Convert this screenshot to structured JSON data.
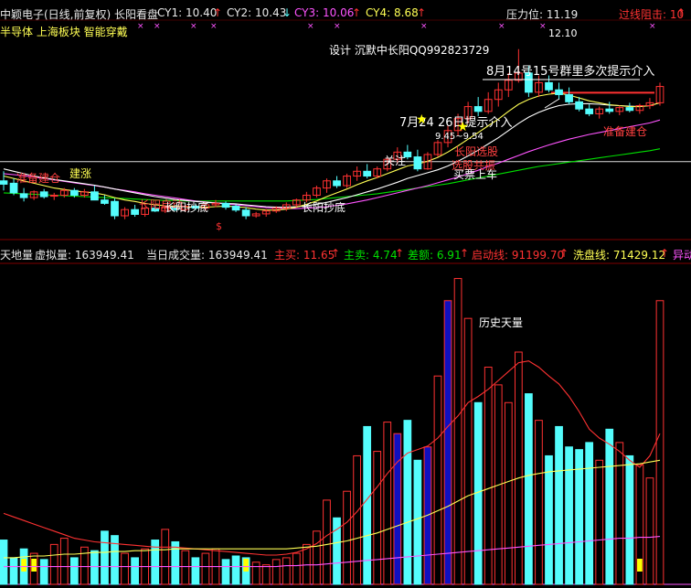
{
  "header1": {
    "title": "中颖电子(日线,前复权) 长阳看盘",
    "cy1": "CY1: 10.40",
    "cy2": "CY2: 10.43",
    "cy3": "CY3: 10.06",
    "cy4": "CY4: 8.68",
    "pressure": "压力位: 11.19",
    "resist": "过线阻击: 10",
    "arrow_up": "↑",
    "arrow_down": "↓"
  },
  "header2": {
    "tags": "半导体 上海板块 智能穿戴"
  },
  "annotations": {
    "design": "设计 沉默中长阳QQ992823729",
    "aug": "8月14号15号群里多次提示介入",
    "jul": "7月24 26日提示介入",
    "price_high": "12.10",
    "range": "9.45~9.54",
    "guanzhu": "关注",
    "changyang_xuangu": "长阳选股",
    "xuangu2": "选股共振",
    "mairu": "买票上车",
    "zhunbei_left": "准备建仓",
    "zhunbei_right": "准备建仓",
    "zhuozhang": "建涨",
    "changyang_qidong": "长阳启动",
    "chaodi1": "长阳抄底",
    "chaodi2": "长阳抄底",
    "s_marker": "$",
    "lishi_tianliang": "历史天量"
  },
  "vol_header": {
    "tiandi": "天地量",
    "xuni": "虚拟量: 163949.41",
    "dangri": "当日成交量: 163949.41",
    "zhumai": "主买: 11.65",
    "zhumai2": "主卖: 4.74",
    "chae": "差额: 6.91",
    "qidong": "启动线: 91199.70",
    "xipan": "洗盘线: 71429.12",
    "yidong": "异动",
    "arrow": "↑"
  },
  "colors": {
    "up": "#ff3232",
    "down": "#54fcfc",
    "ma_white": "#ffffff",
    "ma_yellow": "#ffff54",
    "ma_magenta": "#ff54ff",
    "ma_green": "#00e000",
    "grid": "#800000",
    "label_red": "#ff4040",
    "vol_blue": "#1010c0",
    "vol_yellow": "#ffff00"
  },
  "chart_data": [
    {
      "type": "candlestick",
      "title": "中颖电子(日线,前复权) 长阳看盘",
      "ylim": [
        8.2,
        12.4
      ],
      "reference_lines": {
        "white_line": 9.75,
        "red_line": 11.19
      },
      "candles": [
        {
          "o": 9.35,
          "h": 9.55,
          "l": 9.15,
          "c": 9.28
        },
        {
          "o": 9.3,
          "h": 9.4,
          "l": 9.05,
          "c": 9.1
        },
        {
          "o": 9.08,
          "h": 9.2,
          "l": 8.92,
          "c": 9.0
        },
        {
          "o": 9.0,
          "h": 9.15,
          "l": 8.95,
          "c": 9.12
        },
        {
          "o": 9.12,
          "h": 9.18,
          "l": 8.98,
          "c": 9.02
        },
        {
          "o": 9.03,
          "h": 9.1,
          "l": 8.95,
          "c": 9.05
        },
        {
          "o": 9.05,
          "h": 9.2,
          "l": 9.0,
          "c": 9.15
        },
        {
          "o": 9.15,
          "h": 9.2,
          "l": 9.0,
          "c": 9.05
        },
        {
          "o": 9.05,
          "h": 9.18,
          "l": 9.0,
          "c": 9.12
        },
        {
          "o": 9.12,
          "h": 9.25,
          "l": 9.0,
          "c": 8.95
        },
        {
          "o": 8.95,
          "h": 9.05,
          "l": 8.85,
          "c": 8.88
        },
        {
          "o": 8.92,
          "h": 8.98,
          "l": 8.55,
          "c": 8.62
        },
        {
          "o": 8.62,
          "h": 8.8,
          "l": 8.55,
          "c": 8.75
        },
        {
          "o": 8.75,
          "h": 8.85,
          "l": 8.6,
          "c": 8.65
        },
        {
          "o": 8.65,
          "h": 8.8,
          "l": 8.6,
          "c": 8.78
        },
        {
          "o": 8.78,
          "h": 8.85,
          "l": 8.7,
          "c": 8.72
        },
        {
          "o": 8.72,
          "h": 8.82,
          "l": 8.68,
          "c": 8.8
        },
        {
          "o": 8.8,
          "h": 8.85,
          "l": 8.72,
          "c": 8.75
        },
        {
          "o": 8.75,
          "h": 8.85,
          "l": 8.7,
          "c": 8.82
        },
        {
          "o": 8.82,
          "h": 8.88,
          "l": 8.74,
          "c": 8.78
        },
        {
          "o": 8.78,
          "h": 8.9,
          "l": 8.72,
          "c": 8.85
        },
        {
          "o": 8.85,
          "h": 8.95,
          "l": 8.8,
          "c": 8.88
        },
        {
          "o": 8.88,
          "h": 8.92,
          "l": 8.75,
          "c": 8.8
        },
        {
          "o": 8.82,
          "h": 8.86,
          "l": 8.7,
          "c": 8.74
        },
        {
          "o": 8.74,
          "h": 8.8,
          "l": 8.55,
          "c": 8.62
        },
        {
          "o": 8.62,
          "h": 8.7,
          "l": 8.58,
          "c": 8.66
        },
        {
          "o": 8.66,
          "h": 8.76,
          "l": 8.6,
          "c": 8.72
        },
        {
          "o": 8.72,
          "h": 8.82,
          "l": 8.68,
          "c": 8.78
        },
        {
          "o": 8.78,
          "h": 8.9,
          "l": 8.72,
          "c": 8.85
        },
        {
          "o": 8.85,
          "h": 8.98,
          "l": 8.8,
          "c": 8.95
        },
        {
          "o": 8.95,
          "h": 9.12,
          "l": 8.9,
          "c": 9.05
        },
        {
          "o": 9.05,
          "h": 9.25,
          "l": 9.0,
          "c": 9.2
        },
        {
          "o": 9.2,
          "h": 9.4,
          "l": 9.1,
          "c": 9.35
        },
        {
          "o": 9.35,
          "h": 9.45,
          "l": 9.2,
          "c": 9.25
        },
        {
          "o": 9.25,
          "h": 9.5,
          "l": 9.2,
          "c": 9.45
        },
        {
          "o": 9.45,
          "h": 9.65,
          "l": 9.35,
          "c": 9.55
        },
        {
          "o": 9.55,
          "h": 9.7,
          "l": 9.4,
          "c": 9.45
        },
        {
          "o": 9.45,
          "h": 9.65,
          "l": 9.4,
          "c": 9.6
        },
        {
          "o": 9.6,
          "h": 9.85,
          "l": 9.55,
          "c": 9.8
        },
        {
          "o": 9.8,
          "h": 10.05,
          "l": 9.7,
          "c": 9.95
        },
        {
          "o": 9.95,
          "h": 10.1,
          "l": 9.8,
          "c": 9.85
        },
        {
          "o": 9.85,
          "h": 10.0,
          "l": 9.55,
          "c": 9.6
        },
        {
          "o": 9.6,
          "h": 9.95,
          "l": 9.58,
          "c": 9.9
        },
        {
          "o": 9.9,
          "h": 10.2,
          "l": 9.85,
          "c": 10.15
        },
        {
          "o": 10.15,
          "h": 10.5,
          "l": 10.05,
          "c": 10.4
        },
        {
          "o": 10.4,
          "h": 10.75,
          "l": 10.3,
          "c": 10.65
        },
        {
          "o": 10.65,
          "h": 11.0,
          "l": 10.55,
          "c": 10.9
        },
        {
          "o": 10.9,
          "h": 11.1,
          "l": 10.7,
          "c": 10.8
        },
        {
          "o": 10.8,
          "h": 11.2,
          "l": 10.75,
          "c": 11.05
        },
        {
          "o": 11.05,
          "h": 11.4,
          "l": 10.9,
          "c": 11.25
        },
        {
          "o": 11.25,
          "h": 11.6,
          "l": 11.1,
          "c": 11.45
        },
        {
          "o": 11.45,
          "h": 12.1,
          "l": 11.4,
          "c": 11.6
        },
        {
          "o": 11.6,
          "h": 11.75,
          "l": 11.1,
          "c": 11.2
        },
        {
          "o": 11.2,
          "h": 11.55,
          "l": 11.1,
          "c": 11.4
        },
        {
          "o": 11.4,
          "h": 11.55,
          "l": 11.2,
          "c": 11.25
        },
        {
          "o": 11.25,
          "h": 11.4,
          "l": 11.05,
          "c": 11.15
        },
        {
          "o": 11.15,
          "h": 11.3,
          "l": 10.95,
          "c": 11.0
        },
        {
          "o": 11.0,
          "h": 11.1,
          "l": 10.8,
          "c": 10.85
        },
        {
          "o": 10.85,
          "h": 10.95,
          "l": 10.7,
          "c": 10.75
        },
        {
          "o": 10.75,
          "h": 10.9,
          "l": 10.65,
          "c": 10.85
        },
        {
          "o": 10.85,
          "h": 11.0,
          "l": 10.75,
          "c": 10.8
        },
        {
          "o": 10.8,
          "h": 10.92,
          "l": 10.72,
          "c": 10.88
        },
        {
          "o": 10.88,
          "h": 10.98,
          "l": 10.78,
          "c": 10.82
        },
        {
          "o": 10.82,
          "h": 10.96,
          "l": 10.75,
          "c": 10.92
        },
        {
          "o": 10.92,
          "h": 11.08,
          "l": 10.85,
          "c": 10.98
        },
        {
          "o": 10.98,
          "h": 11.4,
          "l": 10.92,
          "c": 11.32
        }
      ],
      "ma_yellow": [
        9.45,
        9.4,
        9.35,
        9.3,
        9.25,
        9.2,
        9.17,
        9.14,
        9.12,
        9.1,
        9.06,
        9.0,
        8.95,
        8.92,
        8.88,
        8.85,
        8.83,
        8.82,
        8.81,
        8.8,
        8.8,
        8.81,
        8.82,
        8.81,
        8.79,
        8.76,
        8.74,
        8.74,
        8.76,
        8.8,
        8.86,
        8.93,
        9.02,
        9.1,
        9.18,
        9.27,
        9.35,
        9.42,
        9.5,
        9.58,
        9.66,
        9.7,
        9.76,
        9.84,
        9.95,
        10.08,
        10.22,
        10.36,
        10.5,
        10.64,
        10.8,
        10.95,
        11.05,
        11.12,
        11.16,
        11.18,
        11.14,
        11.08,
        11.02,
        10.98,
        10.94,
        10.92,
        10.9,
        10.9,
        10.92,
        10.98
      ],
      "ma_white": [
        9.6,
        9.55,
        9.5,
        9.45,
        9.41,
        9.38,
        9.35,
        9.32,
        9.29,
        9.26,
        9.22,
        9.18,
        9.14,
        9.1,
        9.06,
        9.02,
        8.99,
        8.96,
        8.94,
        8.92,
        8.9,
        8.89,
        8.88,
        8.87,
        8.85,
        8.83,
        8.81,
        8.8,
        8.8,
        8.81,
        8.83,
        8.86,
        8.9,
        8.95,
        9.0,
        9.06,
        9.12,
        9.18,
        9.25,
        9.32,
        9.4,
        9.46,
        9.52,
        9.58,
        9.66,
        9.76,
        9.87,
        9.99,
        10.12,
        10.25,
        10.4,
        10.55,
        10.68,
        10.78,
        10.86,
        10.92,
        10.95,
        10.96,
        10.96,
        10.95,
        10.93,
        10.92,
        10.91,
        10.9,
        10.92,
        10.98
      ],
      "ma_magenta": [
        9.5,
        9.48,
        9.46,
        9.43,
        9.4,
        9.37,
        9.34,
        9.31,
        9.28,
        9.25,
        9.22,
        9.18,
        9.15,
        9.12,
        9.08,
        9.05,
        9.02,
        8.99,
        8.96,
        8.93,
        8.91,
        8.89,
        8.87,
        8.85,
        8.83,
        8.81,
        8.79,
        8.78,
        8.77,
        8.77,
        8.78,
        8.79,
        8.81,
        8.84,
        8.87,
        8.91,
        8.95,
        9.0,
        9.05,
        9.1,
        9.15,
        9.2,
        9.25,
        9.31,
        9.37,
        9.43,
        9.5,
        9.57,
        9.65,
        9.72,
        9.8,
        9.88,
        9.96,
        10.03,
        10.1,
        10.16,
        10.22,
        10.27,
        10.32,
        10.36,
        10.4,
        10.44,
        10.48,
        10.52,
        10.56,
        10.62
      ],
      "ma_green": [
        9.1,
        9.09,
        9.08,
        9.07,
        9.06,
        9.05,
        9.04,
        9.03,
        9.02,
        9.01,
        9.0,
        8.99,
        8.98,
        8.97,
        8.96,
        8.95,
        8.94,
        8.94,
        8.93,
        8.93,
        8.93,
        8.93,
        8.93,
        8.93,
        8.93,
        8.93,
        8.93,
        8.93,
        8.93,
        8.94,
        8.95,
        8.96,
        8.98,
        9.0,
        9.02,
        9.04,
        9.06,
        9.08,
        9.11,
        9.14,
        9.17,
        9.2,
        9.23,
        9.26,
        9.29,
        9.33,
        9.37,
        9.41,
        9.45,
        9.49,
        9.53,
        9.57,
        9.61,
        9.65,
        9.68,
        9.71,
        9.74,
        9.77,
        9.8,
        9.83,
        9.86,
        9.89,
        9.92,
        9.95,
        9.98,
        10.02
      ]
    },
    {
      "type": "bar",
      "title": "天地量",
      "ylim": [
        0,
        360000
      ],
      "volumes": [
        50000,
        30000,
        40000,
        35000,
        28000,
        45000,
        52000,
        30000,
        42000,
        38000,
        60000,
        55000,
        35000,
        30000,
        40000,
        50000,
        62000,
        48000,
        38000,
        30000,
        35000,
        40000,
        28000,
        32000,
        30000,
        25000,
        22000,
        28000,
        30000,
        35000,
        45000,
        60000,
        95000,
        75000,
        105000,
        145000,
        178000,
        150000,
        183000,
        170000,
        185000,
        140000,
        155000,
        235000,
        320000,
        345000,
        300000,
        205000,
        245000,
        225000,
        205000,
        262000,
        215000,
        185000,
        145000,
        178000,
        155000,
        152000,
        160000,
        140000,
        175000,
        160000,
        145000,
        135000,
        120000,
        320000
      ],
      "ma_red": [
        80000,
        76000,
        72000,
        68000,
        64000,
        60000,
        56000,
        52000,
        50000,
        48000,
        47000,
        46000,
        45000,
        44000,
        43000,
        42000,
        42000,
        42000,
        41000,
        40000,
        39000,
        38000,
        37000,
        36000,
        35000,
        34000,
        33000,
        33000,
        34000,
        36000,
        40000,
        46000,
        55000,
        62000,
        70000,
        82000,
        96000,
        110000,
        125000,
        138000,
        148000,
        152000,
        156000,
        165000,
        178000,
        190000,
        205000,
        212000,
        220000,
        230000,
        240000,
        250000,
        252000,
        245000,
        235000,
        226000,
        212000,
        195000,
        175000,
        165000,
        158000,
        150000,
        140000,
        132000,
        145000,
        170000
      ],
      "ma_yellow": [
        30000,
        30000,
        31000,
        32000,
        32000,
        33000,
        34000,
        34000,
        35000,
        36000,
        36000,
        37000,
        37000,
        38000,
        38000,
        39000,
        39000,
        40000,
        40000,
        40000,
        40000,
        40000,
        40000,
        40000,
        40000,
        40000,
        40000,
        40000,
        40000,
        41000,
        42000,
        43000,
        45000,
        47000,
        49000,
        52000,
        55000,
        58000,
        62000,
        66000,
        70000,
        74000,
        78000,
        83000,
        88000,
        94000,
        100000,
        104000,
        108000,
        112000,
        116000,
        120000,
        123000,
        125000,
        127000,
        128000,
        129000,
        130000,
        131000,
        132000,
        133000,
        134000,
        135000,
        136000,
        138000,
        140000
      ],
      "ma_magenta": [
        20000,
        20000,
        20000,
        20000,
        20000,
        20000,
        20000,
        20000,
        20000,
        20000,
        20000,
        20000,
        20000,
        20000,
        20000,
        20000,
        20000,
        20000,
        20000,
        20000,
        20000,
        20000,
        20000,
        20000,
        20000,
        20000,
        20000,
        20000,
        21000,
        21000,
        22000,
        22000,
        23000,
        24000,
        25000,
        26000,
        27000,
        28000,
        29000,
        30000,
        31000,
        32000,
        33000,
        34000,
        35000,
        36000,
        37000,
        38000,
        39000,
        40000,
        41000,
        42000,
        43000,
        44000,
        45000,
        46000,
        47000,
        48000,
        49000,
        50000,
        51000,
        52000,
        52000,
        53000,
        53000,
        54000
      ]
    }
  ]
}
